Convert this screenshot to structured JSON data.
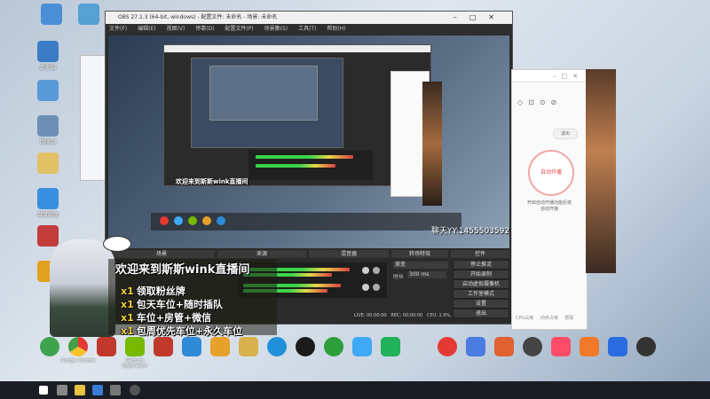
{
  "desktop_icons": [
    {
      "label": "",
      "color": "#4a8fd6"
    },
    {
      "label": "此电脑",
      "color": "#3c7cc4"
    },
    {
      "label": "",
      "color": "#5a9ad8"
    },
    {
      "label": "",
      "color": "#7aa6cf"
    },
    {
      "label": "回收站",
      "color": "#6d8fb5"
    },
    {
      "label": "",
      "color": "#e2c066"
    },
    {
      "label": "",
      "color": "#56a0d4"
    },
    {
      "label": "百度网盘",
      "color": "#3a8fe0"
    },
    {
      "label": "",
      "color": "#c23c3c"
    },
    {
      "label": "",
      "color": "#e0a020"
    },
    {
      "label": "",
      "color": "#d83a5a"
    }
  ],
  "obs": {
    "title": "OBS 27.1.3 (64-bit, windows) - 配置文件: 未命名 - 场景: 未命名",
    "menu": [
      "文件(F)",
      "编辑(E)",
      "视图(V)",
      "停靠(D)",
      "配置文件(P)",
      "场景集(S)",
      "工具(T)",
      "帮助(H)"
    ],
    "panels": [
      "场景",
      "来源",
      "混音器",
      "转场特效",
      "控件"
    ],
    "controls": [
      "停止推流",
      "开始录制",
      "启动虚拟摄像机",
      "工作室模式",
      "设置",
      "退出"
    ],
    "transition": "渐变",
    "duration_label": "时长",
    "duration_value": "300 ms",
    "status": {
      "live": "LIVE: 00:00:00",
      "rec": "REC: 00:00:00",
      "cpu": "CPU: 1.9%, 60.00 fps"
    }
  },
  "banner": {
    "title": "欢迎来到斯斯wink直播间",
    "items": [
      "领取粉丝牌",
      "包天车位+随时插队",
      "车位+房管+微信",
      "包周优先车位+永久车位"
    ],
    "mark": "x1"
  },
  "watermark": "聊天YY:1455503592",
  "right_window": {
    "button1": "退出",
    "button2": "自动开播",
    "text1": "开启自动开播功能后将",
    "text2": "自动开播",
    "bottom": [
      "CPU占用",
      "内存占用",
      "帮助"
    ]
  },
  "apps": [
    {
      "label": "",
      "color": "#3fa34d"
    },
    {
      "label": "Google Chrome",
      "color": "#e8e8e8"
    },
    {
      "label": "",
      "color": "#c0392b"
    },
    {
      "label": "GeForce Experience",
      "color": "#76b900"
    },
    {
      "label": "",
      "color": "#c0392b"
    },
    {
      "label": "",
      "color": "#2f8ad6"
    },
    {
      "label": "",
      "color": "#e6a12a"
    },
    {
      "label": "",
      "color": "#d8b04c"
    },
    {
      "label": "",
      "color": "#1f8fd8"
    },
    {
      "label": "",
      "color": "#1b1b1b"
    },
    {
      "label": "",
      "color": "#2d9e3a"
    },
    {
      "label": "",
      "color": "#3fa9f5"
    },
    {
      "label": "",
      "color": "#20b15a"
    },
    {
      "label": "",
      "color": "#e53935"
    },
    {
      "label": "",
      "color": "#4a7be0"
    },
    {
      "label": "",
      "color": "#e06030"
    },
    {
      "label": "",
      "color": "#444444"
    },
    {
      "label": "",
      "color": "#ff4c6a"
    },
    {
      "label": "",
      "color": "#f07a2a"
    },
    {
      "label": "",
      "color": "#2a6be0"
    },
    {
      "label": "",
      "color": "#333333"
    }
  ],
  "taskbar": {
    "start_color": "#ffffff"
  }
}
